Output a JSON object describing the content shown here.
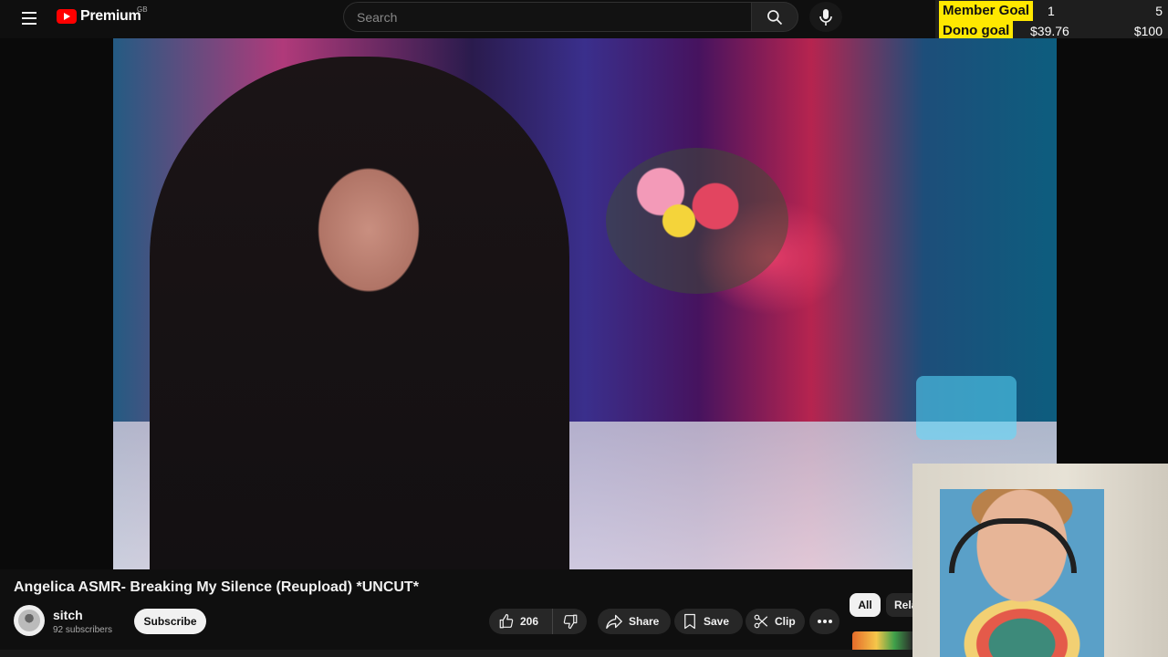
{
  "header": {
    "brand": "Premium",
    "region": "GB",
    "search_placeholder": "Search"
  },
  "goals": {
    "member": {
      "label": "Member Goal",
      "current": "1",
      "target": "5"
    },
    "dono": {
      "label": "Dono goal",
      "current": "$39.76",
      "target": "$100"
    }
  },
  "video": {
    "title": "Angelica ASMR- Breaking My Silence (Reupload) *UNCUT*"
  },
  "channel": {
    "name": "sitch",
    "subscribers": "92 subscribers",
    "subscribe_label": "Subscribe"
  },
  "actions": {
    "likes": "206",
    "share": "Share",
    "save": "Save",
    "clip": "Clip"
  },
  "chips": {
    "all": "All",
    "related": "Related"
  },
  "colors": {
    "accent": "#ff0000",
    "goal_highlight": "#ffe800",
    "background": "#0f0f0f"
  }
}
